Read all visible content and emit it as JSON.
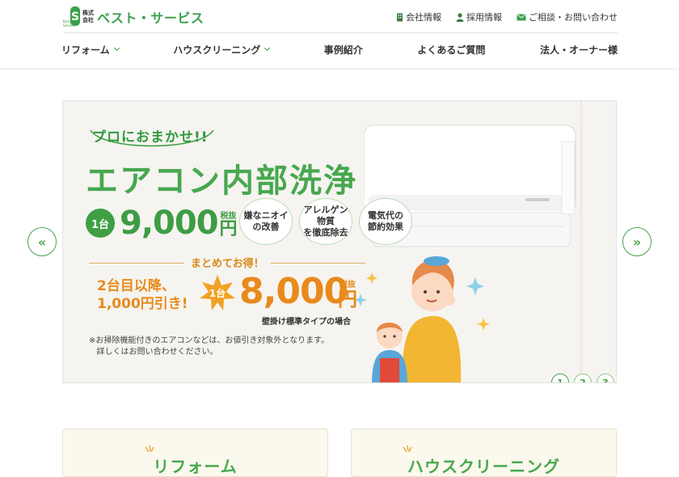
{
  "header": {
    "logo": {
      "kaisha_line1": "株式",
      "kaisha_line2": "会社",
      "name": "ベスト・サービス",
      "mark_text": "Best Service"
    },
    "utility_links": [
      {
        "label": "会社情報",
        "icon": "building-icon"
      },
      {
        "label": "採用情報",
        "icon": "person-icon"
      },
      {
        "label": "ご相談・お問い合わせ",
        "icon": "mail-icon"
      }
    ],
    "nav": [
      {
        "label": "リフォーム",
        "has_dropdown": true
      },
      {
        "label": "ハウスクリーニング",
        "has_dropdown": true
      },
      {
        "label": "事例紹介",
        "has_dropdown": false
      },
      {
        "label": "よくあるご質問",
        "has_dropdown": false
      },
      {
        "label": "法人・オーナー様",
        "has_dropdown": false
      }
    ]
  },
  "hero": {
    "catch": "プロにおまかせ!!",
    "headline": "エアコン内部洗浄",
    "unit_label": "1台",
    "price": "9,000",
    "tax_label": "税抜",
    "yen": "円",
    "badges": [
      {
        "line1": "嫌なニオイ",
        "line2": "の改善"
      },
      {
        "line1": "アレルゲン物質",
        "line2": "を徹底除去"
      },
      {
        "line1": "電気代の",
        "line2": "節約効果"
      }
    ],
    "deal_title": "まとめてお得！",
    "deal_line1": "2台目以降、",
    "deal_line2": "1,000円引き!",
    "deal_unit": "1台",
    "deal_price": "8,000",
    "deal_tax": "税抜",
    "deal_yen": "円",
    "deal_sub": "壁掛け標準タイプの場合",
    "note_line1": "※お掃除機能付きのエアコンなどは、お値引き対象外となります。",
    "note_line2": "詳しくはお問い合わせください。"
  },
  "slider": {
    "pages": [
      "1",
      "2",
      "3"
    ],
    "active_page": 1,
    "prev_label": "«",
    "next_label": "»"
  },
  "cards": [
    {
      "title": "リフォーム"
    },
    {
      "title": "ハウスクリーニング"
    }
  ],
  "colors": {
    "brand_green": "#3aa04a",
    "accent_orange": "#e88a1c",
    "card_bg": "#fbf8ed"
  }
}
